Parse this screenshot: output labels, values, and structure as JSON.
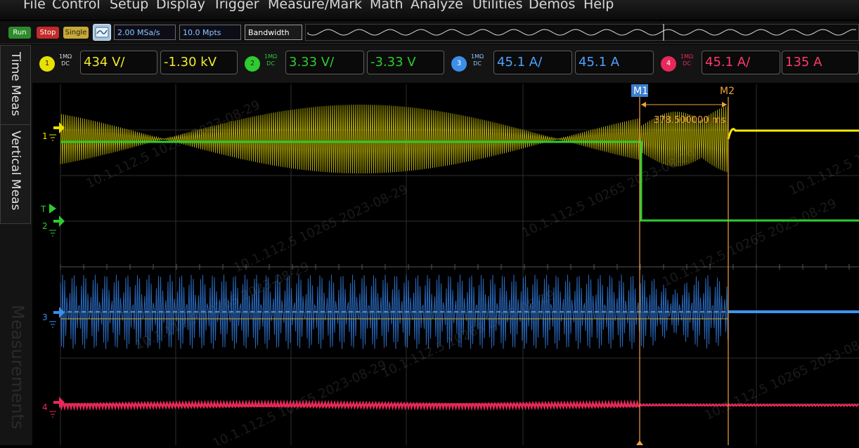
{
  "menu": [
    "File",
    "Control",
    "Setup",
    "Display",
    "Trigger",
    "Measure/Mark",
    "Math",
    "Analyze",
    "Utilities",
    "Demos",
    "Help"
  ],
  "toolbar": {
    "run_label": "Run",
    "stop_label": "Stop",
    "single_label": "Single",
    "sample_rate": "2.00 MSa/s",
    "memory_depth": "10.0 Mpts",
    "bandwidth_label": "Bandwidth"
  },
  "channels": [
    {
      "num": "1",
      "impedance": "1MΩ",
      "coupling": "DC",
      "scale": "434 V/",
      "offset": "-1.30 kV",
      "color": "#e8e000"
    },
    {
      "num": "2",
      "impedance": "1MΩ",
      "coupling": "DC",
      "scale": "3.33 V/",
      "offset": "-3.33 V",
      "color": "#2ecc2e"
    },
    {
      "num": "3",
      "impedance": "1MΩ",
      "coupling": "DC",
      "scale": "45.1 A/",
      "offset": "45.1 A",
      "color": "#3b8fe8"
    },
    {
      "num": "4",
      "impedance": "1MΩ",
      "coupling": "DC",
      "scale": "45.1 A/",
      "offset": "135 A",
      "color": "#e8285a"
    }
  ],
  "side_tabs": {
    "time_meas": "Time Meas",
    "vertical_meas": "Vertical Meas",
    "measurements": "Measurements"
  },
  "markers": {
    "m1": "M1",
    "m2": "M2",
    "delta": "378.500000 ms"
  },
  "channel_markers": {
    "ch1": "1",
    "trigger": "T",
    "ch2": "2",
    "ch3": "3",
    "ch4": "4"
  },
  "watermark": "10.1.112.5  10265 2023-08-29",
  "colors": {
    "ch1": "#e8e000",
    "ch2": "#2ecc2e",
    "ch3": "#3b8fe8",
    "ch4": "#e8285a",
    "marker": "#f0a040",
    "marker_label": "#3a7fd0"
  }
}
